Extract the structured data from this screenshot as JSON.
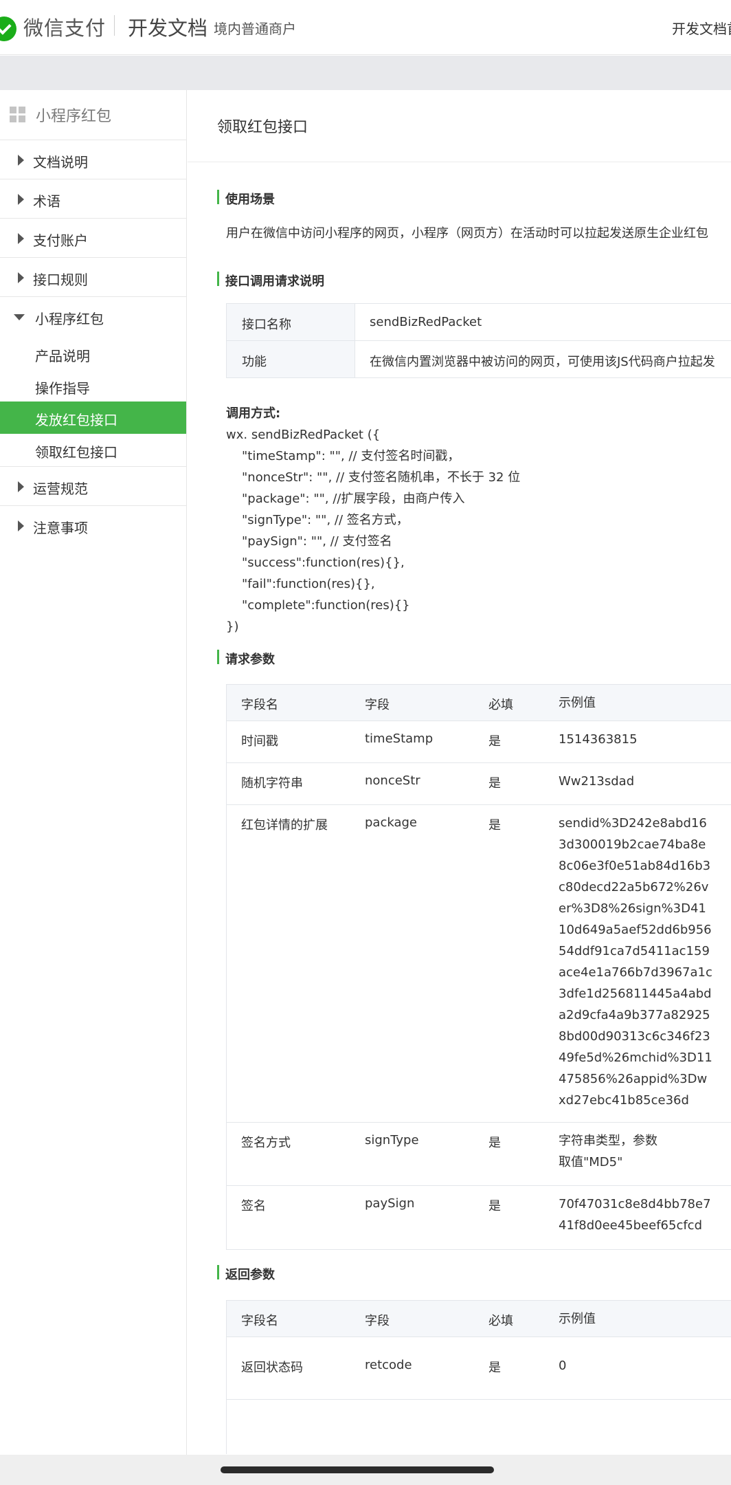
{
  "header": {
    "brand": "微信支付",
    "doc_title": "开发文档",
    "region": "境内普通商户",
    "right_link": "开发文档首"
  },
  "sidebar": {
    "head": "小程序红包",
    "items": [
      {
        "label": "文档说明"
      },
      {
        "label": "术语"
      },
      {
        "label": "支付账户"
      },
      {
        "label": "接口规则"
      },
      {
        "label": "小程序红包"
      },
      {
        "label": "运营规范"
      },
      {
        "label": "注意事项"
      }
    ],
    "sub_items": [
      {
        "label": "产品说明"
      },
      {
        "label": "操作指导"
      },
      {
        "label": "发放红包接口"
      },
      {
        "label": "领取红包接口"
      }
    ],
    "active": "发放红包接口"
  },
  "main": {
    "title": "领取红包接口",
    "sections": {
      "scene": "使用场景",
      "call_desc": "接口调用请求说明",
      "req_params": "请求参数",
      "resp_params": "返回参数"
    },
    "scene_text": "用户在微信中访问小程序的网页，小程序（网页方）在活动时可以拉起发送原生企业红包",
    "info": [
      {
        "key": "接口名称",
        "value": "sendBizRedPacket"
      },
      {
        "key": "功能",
        "value": "在微信内置浏览器中被访问的网页，可使用该JS代码商户拉起发"
      }
    ],
    "code": {
      "label": "调用方式:",
      "open": "wx. sendBizRedPacket ({",
      "lines": [
        "\"timeStamp\": \"\", // 支付签名时间戳，",
        "\"nonceStr\": \"\", // 支付签名随机串，不长于 32 位",
        "\"package\": \"\", //扩展字段，由商户传入",
        "\"signType\": \"\", // 签名方式，",
        "\"paySign\": \"\", // 支付签名",
        "\"success\":function(res){},",
        "\"fail\":function(res){},",
        "\"complete\":function(res){}"
      ],
      "close": "})"
    },
    "table_headers": [
      "字段名",
      "字段",
      "必填",
      "示例值"
    ],
    "req_rows": [
      {
        "name": "时间戳",
        "field": "timeStamp",
        "req": "是",
        "example": "1514363815"
      },
      {
        "name": "随机字符串",
        "field": "nonceStr",
        "req": "是",
        "example": "Ww213sdad"
      },
      {
        "name": "红包详情的扩展",
        "field": "package",
        "req": "是",
        "example": "sendid%3D242e8abd163d300019b2cae74ba8e8c06e3f0e51ab84d16b3c80decd22a5b672%26ver%3D8%26sign%3D4110d649a5aef52dd6b95654ddf91ca7d5411ac159ace4e1a766b7d3967a1c3dfe1d256811445a4abda2d9cfa4a9b377a829258bd00d90313c6c346f2349fe5d%26mchid%3D11475856%26appid%3Dwxd27ebc41b85ce36d"
      },
      {
        "name": "签名方式",
        "field": "signType",
        "req": "是",
        "example": "字符串类型，参数取值\"MD5\""
      },
      {
        "name": "签名",
        "field": "paySign",
        "req": "是",
        "example": "70f47031c8e8d4bb78e741f8d0ee45beef65cfcd"
      }
    ],
    "resp_rows": [
      {
        "name": "返回状态码",
        "field": "retcode",
        "req": "是",
        "example": "0"
      }
    ]
  }
}
